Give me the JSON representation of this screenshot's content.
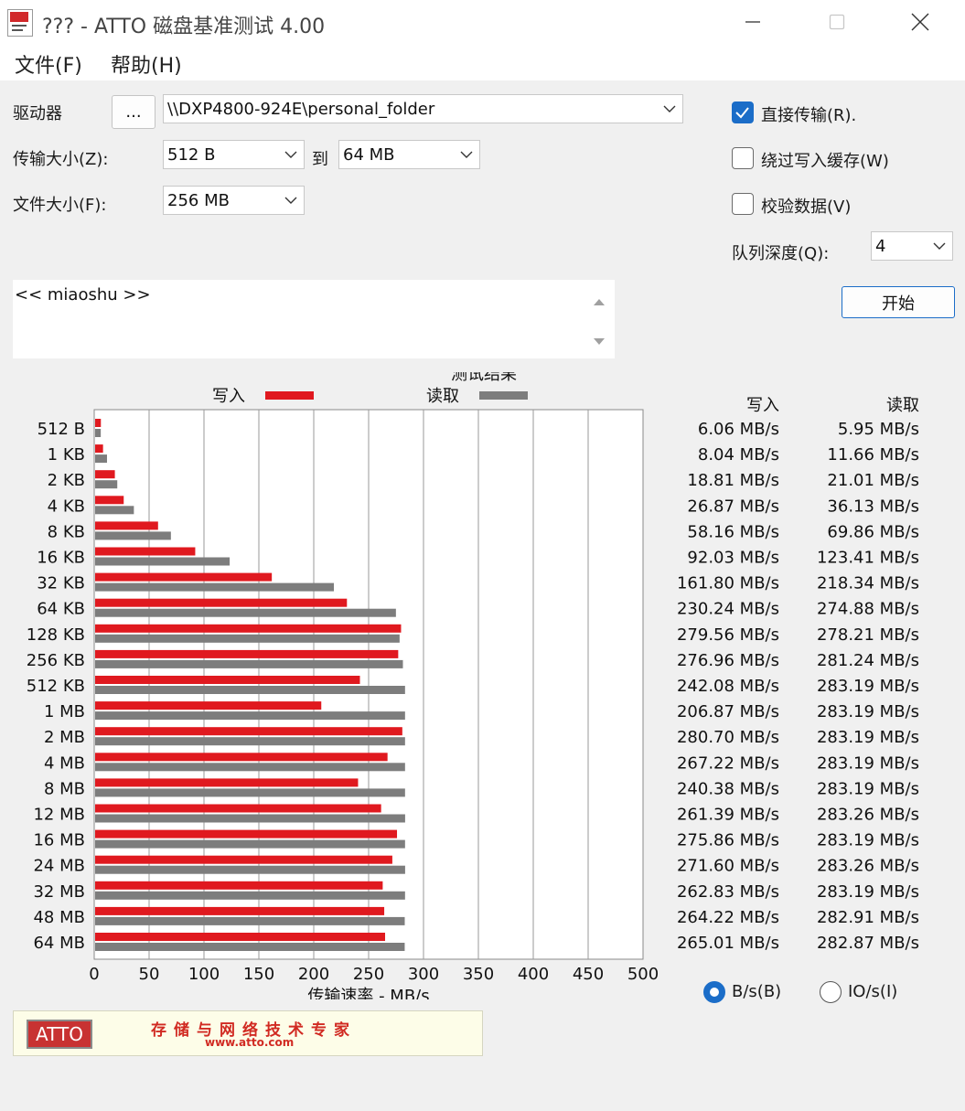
{
  "window": {
    "title": "??? - ATTO 磁盘基准测试 4.00"
  },
  "menu": {
    "file": "文件(F)",
    "help": "帮助(H)"
  },
  "settings": {
    "drive_label": "驱动器",
    "browse_button": "...",
    "drive_value": "\\\\DXP4800-924E\\personal_folder",
    "transfer_size_label": "传输大小(Z):",
    "transfer_from": "512 B",
    "to_label": "到",
    "transfer_to": "64 MB",
    "file_size_label": "文件大小(F):",
    "file_size": "256 MB",
    "direct_io_label": "直接传输(R).",
    "direct_io_checked": true,
    "bypass_cache_label": "绕过写入缓存(W)",
    "bypass_cache_checked": false,
    "verify_label": "校验数据(V)",
    "verify_checked": false,
    "queue_depth_label": "队列深度(Q):",
    "queue_depth": "4",
    "start_button": "开始"
  },
  "description": {
    "text": "<< miaoshu >>"
  },
  "results": {
    "heading": "测试结果",
    "write_header": "写入",
    "read_header": "读取",
    "unit_bytes_label": "B/s(B)",
    "unit_io_label": "IO/s(I)",
    "unit_selected": "B/s",
    "write_text": [
      "6.06 MB/s",
      "8.04 MB/s",
      "18.81 MB/s",
      "26.87 MB/s",
      "58.16 MB/s",
      "92.03 MB/s",
      "161.80 MB/s",
      "230.24 MB/s",
      "279.56 MB/s",
      "276.96 MB/s",
      "242.08 MB/s",
      "206.87 MB/s",
      "280.70 MB/s",
      "267.22 MB/s",
      "240.38 MB/s",
      "261.39 MB/s",
      "275.86 MB/s",
      "271.60 MB/s",
      "262.83 MB/s",
      "264.22 MB/s",
      "265.01 MB/s"
    ],
    "read_text": [
      "5.95 MB/s",
      "11.66 MB/s",
      "21.01 MB/s",
      "36.13 MB/s",
      "69.86 MB/s",
      "123.41 MB/s",
      "218.34 MB/s",
      "274.88 MB/s",
      "278.21 MB/s",
      "281.24 MB/s",
      "283.19 MB/s",
      "283.19 MB/s",
      "283.19 MB/s",
      "283.19 MB/s",
      "283.19 MB/s",
      "283.26 MB/s",
      "283.19 MB/s",
      "283.26 MB/s",
      "283.19 MB/s",
      "282.91 MB/s",
      "282.87 MB/s"
    ]
  },
  "chart_data": {
    "type": "bar",
    "orientation": "horizontal",
    "title": "测试结果",
    "xlabel": "传输速率 - MB/s",
    "xlim": [
      0,
      500
    ],
    "x_ticks": [
      0,
      50,
      100,
      150,
      200,
      250,
      300,
      350,
      400,
      450,
      500
    ],
    "grid": true,
    "legend_position": "top",
    "categories": [
      "512 B",
      "1 KB",
      "2 KB",
      "4 KB",
      "8 KB",
      "16 KB",
      "32 KB",
      "64 KB",
      "128 KB",
      "256 KB",
      "512 KB",
      "1 MB",
      "2 MB",
      "4 MB",
      "8 MB",
      "12 MB",
      "16 MB",
      "24 MB",
      "32 MB",
      "48 MB",
      "64 MB"
    ],
    "series": [
      {
        "name": "写入",
        "color": "#e0191f",
        "values": [
          6.06,
          8.04,
          18.81,
          26.87,
          58.16,
          92.03,
          161.8,
          230.24,
          279.56,
          276.96,
          242.08,
          206.87,
          280.7,
          267.22,
          240.38,
          261.39,
          275.86,
          271.6,
          262.83,
          264.22,
          265.01
        ]
      },
      {
        "name": "读取",
        "color": "#7d7d7d",
        "values": [
          5.95,
          11.66,
          21.01,
          36.13,
          69.86,
          123.41,
          218.34,
          274.88,
          278.21,
          281.24,
          283.19,
          283.19,
          283.19,
          283.19,
          283.19,
          283.26,
          283.19,
          283.26,
          283.19,
          282.91,
          282.87
        ]
      }
    ]
  },
  "banner": {
    "logo_text": "ATTO",
    "slogan": "存储与网络技术专家",
    "url": "www.atto.com"
  },
  "icons": {
    "minimize": "minimize-icon",
    "maximize": "maximize-icon",
    "close": "close-icon",
    "dropdown": "chevron-down-icon",
    "scroll_up": "scroll-up-icon",
    "scroll_down": "scroll-down-icon"
  },
  "colors": {
    "accent": "#1b6dc8",
    "write_bar": "#e0191f",
    "read_bar": "#7d7d7d"
  }
}
